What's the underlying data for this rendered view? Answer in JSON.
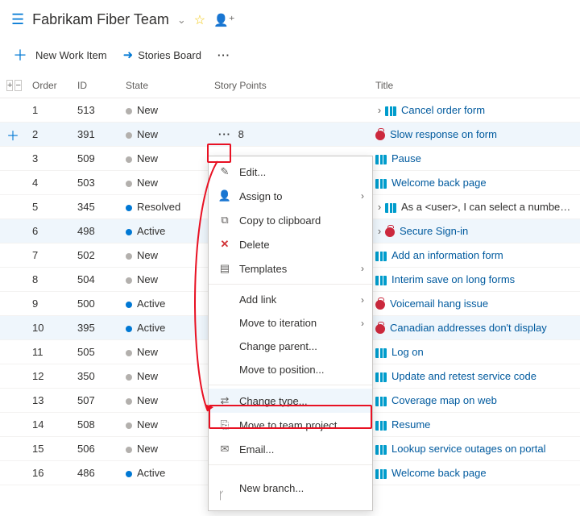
{
  "header": {
    "team_name": "Fabrikam Fiber Team"
  },
  "toolbar": {
    "new_item": "New Work Item",
    "stories_board": "Stories Board"
  },
  "columns": {
    "order": "Order",
    "id": "ID",
    "state": "State",
    "story_points": "Story Points",
    "title": "Title"
  },
  "selected_sp": "8",
  "rows": [
    {
      "order": "1",
      "id": "513",
      "state": "New",
      "state_kind": "new",
      "sp": "",
      "kind": "story",
      "title": "Cancel order form",
      "expand": ">",
      "link": true
    },
    {
      "order": "2",
      "id": "391",
      "state": "New",
      "state_kind": "new",
      "sp": "8",
      "kind": "bug",
      "title": "Slow response on form",
      "link": true,
      "selected": true,
      "addplus": true
    },
    {
      "order": "3",
      "id": "509",
      "state": "New",
      "state_kind": "new",
      "sp": "",
      "kind": "story",
      "title": "Pause",
      "link": true
    },
    {
      "order": "4",
      "id": "503",
      "state": "New",
      "state_kind": "new",
      "sp": "",
      "kind": "story",
      "title": "Welcome back page",
      "link": true
    },
    {
      "order": "5",
      "id": "345",
      "state": "Resolved",
      "state_kind": "resolved",
      "sp": "",
      "kind": "story",
      "title": "As a <user>, I can select a number ...",
      "expand": ">",
      "link": false
    },
    {
      "order": "6",
      "id": "498",
      "state": "Active",
      "state_kind": "active",
      "sp": "",
      "kind": "bug",
      "title": "Secure Sign-in",
      "expand": ">",
      "link": true,
      "sel2": true
    },
    {
      "order": "7",
      "id": "502",
      "state": "New",
      "state_kind": "new",
      "sp": "",
      "kind": "story",
      "title": "Add an information form",
      "link": true
    },
    {
      "order": "8",
      "id": "504",
      "state": "New",
      "state_kind": "new",
      "sp": "",
      "kind": "story",
      "title": "Interim save on long forms",
      "link": true
    },
    {
      "order": "9",
      "id": "500",
      "state": "Active",
      "state_kind": "active",
      "sp": "",
      "kind": "bug",
      "title": "Voicemail hang issue",
      "link": true
    },
    {
      "order": "10",
      "id": "395",
      "state": "Active",
      "state_kind": "active",
      "sp": "",
      "kind": "bug",
      "title": "Canadian addresses don't display",
      "link": true,
      "sel2": true
    },
    {
      "order": "11",
      "id": "505",
      "state": "New",
      "state_kind": "new",
      "sp": "",
      "kind": "story",
      "title": "Log on",
      "link": true
    },
    {
      "order": "12",
      "id": "350",
      "state": "New",
      "state_kind": "new",
      "sp": "",
      "kind": "story",
      "title": "Update and retest service code",
      "link": true
    },
    {
      "order": "13",
      "id": "507",
      "state": "New",
      "state_kind": "new",
      "sp": "",
      "kind": "story",
      "title": "Coverage map on web",
      "link": true
    },
    {
      "order": "14",
      "id": "508",
      "state": "New",
      "state_kind": "new",
      "sp": "",
      "kind": "story",
      "title": "Resume",
      "link": true
    },
    {
      "order": "15",
      "id": "506",
      "state": "New",
      "state_kind": "new",
      "sp": "",
      "kind": "story",
      "title": "Lookup service outages on portal",
      "link": true
    },
    {
      "order": "16",
      "id": "486",
      "state": "Active",
      "state_kind": "active",
      "sp": "",
      "kind": "story",
      "title": "Welcome back page",
      "link": true
    }
  ],
  "menu": {
    "edit": "Edit...",
    "assign": "Assign to",
    "copy": "Copy to clipboard",
    "delete": "Delete",
    "templates": "Templates",
    "add_link": "Add link",
    "move_iter": "Move to iteration",
    "change_parent": "Change parent...",
    "move_pos": "Move to position...",
    "change_type": "Change type...",
    "move_team": "Move to team project...",
    "email": "Email...",
    "new_branch": "New branch..."
  }
}
